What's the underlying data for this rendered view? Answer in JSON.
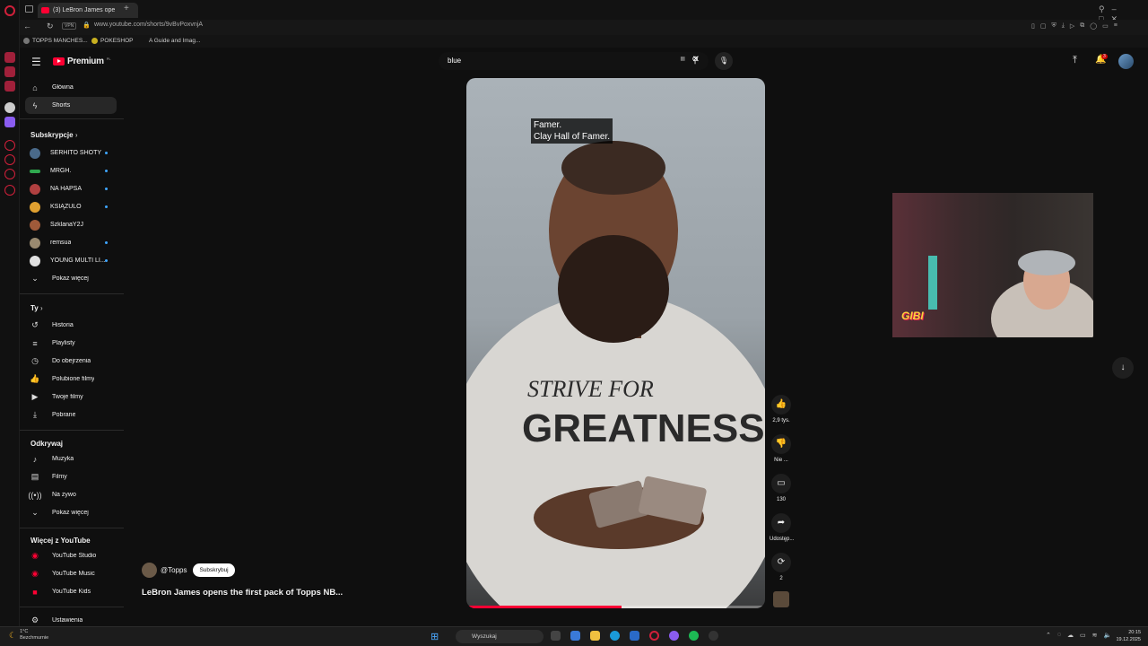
{
  "browser": {
    "tab_title": "(3) LeBron James ope",
    "url": "www.youtube.com/shorts/9vBvPoxvnjA",
    "bookmarks": [
      "TOPPS MANCHES...",
      "POKESHOP",
      "A Guide and Imag..."
    ]
  },
  "header": {
    "logo": "Premium",
    "logo_region": "PL",
    "search_value": "blue",
    "notification_count": "3"
  },
  "sidebar": {
    "main": [
      {
        "label": "Główna",
        "icon": "home-icon"
      },
      {
        "label": "Shorts",
        "icon": "shorts-icon"
      }
    ],
    "subscriptions_heading": "Subskrypcje",
    "subscriptions": [
      {
        "label": "SERHITO SHOTY",
        "live": true,
        "color": "#4a6a8a"
      },
      {
        "label": "MRGH.",
        "live": true,
        "color": "#2fa84f"
      },
      {
        "label": "NA HAPSA",
        "live": true,
        "color": "#b04040"
      },
      {
        "label": "KSIĄŻULO",
        "live": true,
        "color": "#e0a030"
      },
      {
        "label": "SzklanaY2J",
        "live": false,
        "color": "#a05a3a"
      },
      {
        "label": "remsua",
        "live": true,
        "color": "#9a8a70"
      },
      {
        "label": "YOUNG MULTI LI...",
        "live": true,
        "color": "#e0e0e0"
      }
    ],
    "show_more_subs": "Pokaż więcej",
    "you_heading": "Ty",
    "you_items": [
      {
        "label": "Historia",
        "icon": "history-icon"
      },
      {
        "label": "Playlisty",
        "icon": "playlist-icon"
      },
      {
        "label": "Do obejrzenia",
        "icon": "watch-later-icon"
      },
      {
        "label": "Polubione filmy",
        "icon": "like-icon"
      },
      {
        "label": "Twoje filmy",
        "icon": "your-videos-icon"
      },
      {
        "label": "Pobrane",
        "icon": "download-icon"
      }
    ],
    "explore_heading": "Odkrywaj",
    "explore_items": [
      {
        "label": "Muzyka",
        "icon": "music-icon"
      },
      {
        "label": "Filmy",
        "icon": "movies-icon"
      },
      {
        "label": "Na żywo",
        "icon": "live-icon"
      },
      {
        "label": "Pokaż więcej",
        "icon": "chevron-down-icon"
      }
    ],
    "more_heading": "Więcej z YouTube",
    "more_items": [
      {
        "label": "YouTube Studio",
        "icon": "yt-studio-icon"
      },
      {
        "label": "YouTube Music",
        "icon": "yt-music-icon"
      },
      {
        "label": "YouTube Kids",
        "icon": "yt-kids-icon"
      }
    ],
    "settings": "Ustawienia"
  },
  "short": {
    "caption_line1": "Famer.",
    "caption_line2": "Clay Hall of Famer.",
    "channel": "@Topps",
    "subscribe": "Subskrybuj",
    "title": "LeBron James opens the first pack of Topps NB...",
    "progress": 0.52,
    "shirt_line1": "STRIVE FOR",
    "shirt_line2": "GREATNESS"
  },
  "actions": {
    "likes": "2,9 tys.",
    "dislike": "Nie ...",
    "comments": "130",
    "share": "Udostęp...",
    "remix": "2"
  },
  "webcam": {
    "tag": "GIBI"
  },
  "taskbar": {
    "temperature": "1°C",
    "weather": "Bezchmurnie",
    "search": "Wyszukaj",
    "time": "20:15",
    "date": "19.12.2025"
  }
}
